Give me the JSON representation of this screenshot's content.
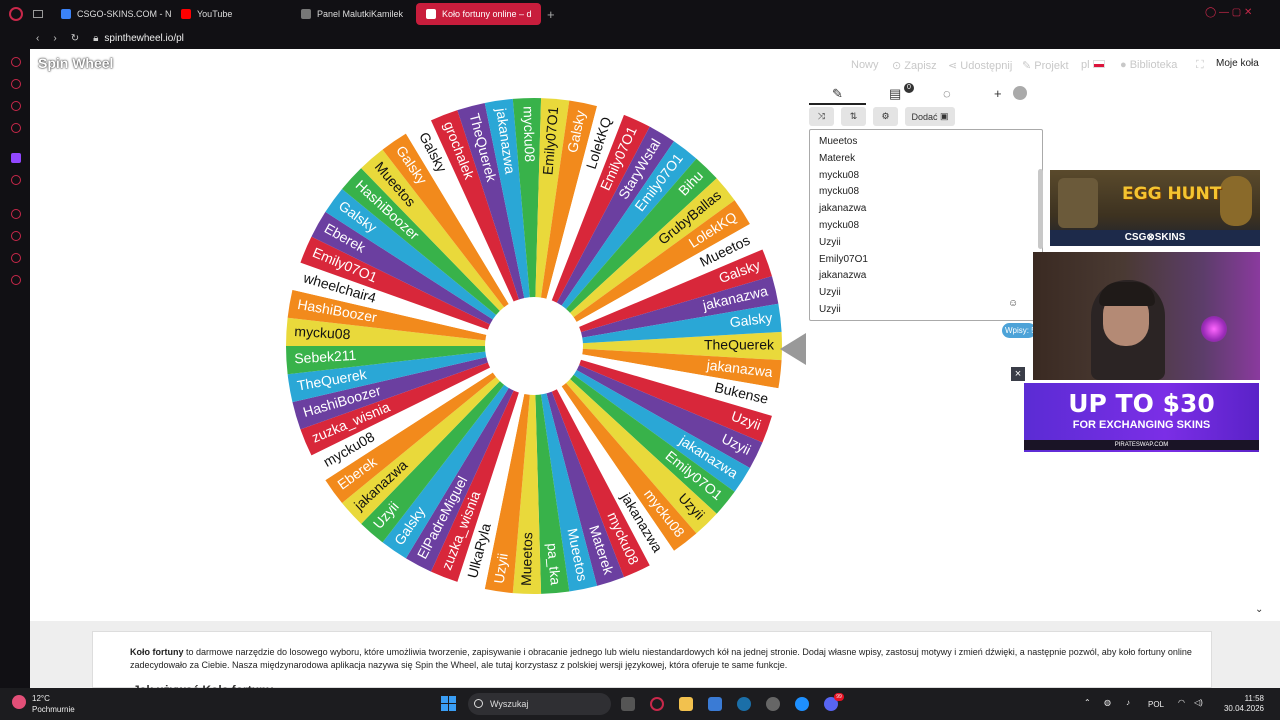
{
  "browser": {
    "tabs": [
      {
        "label": "CSGO-SKINS.COM - Najle",
        "color": "#3b82f6"
      },
      {
        "label": "YouTube",
        "color": "#ff0000"
      },
      {
        "label": "Panel MalutkiKamilek",
        "color": "#777777"
      },
      {
        "label": "Koło fortuny online – d",
        "color": "#ffffff"
      }
    ],
    "url": "spinthewheel.io/pl"
  },
  "site": {
    "logo": "Spin Wheel",
    "nav": [
      "Nowy",
      "Zapisz",
      "Udostępnij",
      "Projekt",
      "pl",
      "Biblioteka"
    ],
    "my_wheels": "Moje koła"
  },
  "wheel": {
    "colors": [
      "#e9d93b",
      "#2aa7d6",
      "#d8273a",
      "#f28a1c",
      "#38b24a",
      "#6b3fa0",
      "#ffffff"
    ],
    "labels": [
      "TheQuerek",
      "jakanazwa",
      "Bukense",
      "Uzyii",
      "Uzyii",
      "jakanazwa",
      "Emily07O1",
      "Uzyii",
      "mycku08",
      "jakanazwa",
      "mycku08",
      "Materek",
      "Mueetos",
      "pa_tka",
      "Mueetos",
      "Uzyii",
      "UlkaRyla",
      "zuzka_wisnia",
      "ElPadreMiguel",
      "Galsky",
      "Uzyii",
      "jakanazwa",
      "Eberek",
      "mycku08",
      "zuzka_wisnia",
      "HashiBoozer",
      "TheQuerek",
      "Sebek211",
      "mycku08",
      "HashiBoozer",
      "wheelchair4",
      "Emily07O1",
      "Eberek",
      "Galsky",
      "HashiBoozer",
      "Mueetos",
      "Galsky",
      "Galsky",
      "grochalek",
      "TheQuerek",
      "jakanazwa",
      "mycku08",
      "Emily07O1",
      "Galsky",
      "LolekKQ",
      "Emily07O1",
      "StaryWstal",
      "Emily07O1",
      "Bihu",
      "GrubyBallas",
      "LolekKQ",
      "Mueetos",
      "Galsky",
      "jakanazwa",
      "Galsky"
    ]
  },
  "panel": {
    "add_label": "Dodać",
    "badge": "0",
    "entries": [
      "Mueetos",
      "Materek",
      "mycku08",
      "mycku08",
      "jakanazwa",
      "mycku08",
      "Uzyii",
      "Emily07O1",
      "jakanazwa",
      "Uzyii",
      "Uzyii"
    ],
    "entries_count_label": "Wpisy: 5"
  },
  "ads": {
    "egg_title": "EGG HUNT",
    "egg_brand": "CSG⊗SKINS",
    "pirate_title": "UP TO $30",
    "pirate_sub": "FOR EXCHANGING SKINS",
    "pirate_domain": "PIRATESWAP.COM",
    "close": "×"
  },
  "info": {
    "bold": "Koło fortuny",
    "text": " to darmowe narzędzie do losowego wyboru, które umożliwia tworzenie, zapisywanie i obracanie jednego lub wielu niestandardowych kół na jednej stronie. Dodaj własne wpisy, zastosuj motywy i zmień dźwięki, a następnie pozwól, aby koło fortuny online zadecydowało za Ciebie. Nasza międzynarodowa aplikacja nazywa się Spin the Wheel, ale tutaj korzystasz z polskiej wersji językowej, która oferuje te same funkcje.",
    "heading": "Jak używać Koła fortuny"
  },
  "taskbar": {
    "temp": "12°C",
    "weather": "Pochmurnie",
    "search": "Wyszukaj",
    "lang": "POL",
    "time": "11:58",
    "date": "30.04.2026",
    "discord_badge": "99"
  }
}
